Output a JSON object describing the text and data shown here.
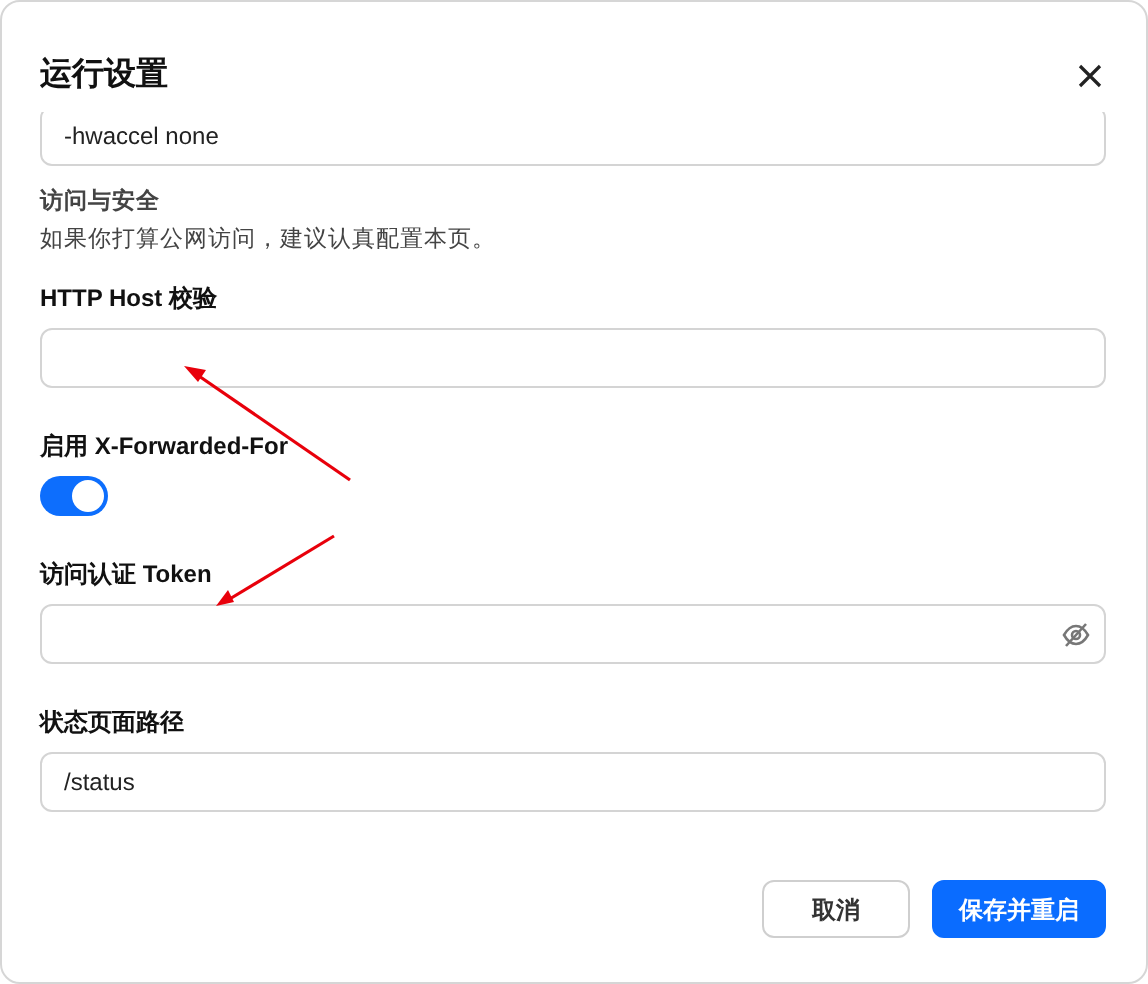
{
  "dialog": {
    "title": "运行设置"
  },
  "items": [
    {
      "kind": "input",
      "value": "-hwaccel none"
    },
    {
      "kind": "section",
      "title": "访问与安全",
      "description": "如果你打算公网访问，建议认真配置本页。"
    },
    {
      "kind": "input",
      "label": "HTTP Host 校验"
    },
    {
      "kind": "switch",
      "label": "启用 X-Forwarded-For",
      "on": true
    },
    {
      "kind": "password",
      "label": "访问认证 Token"
    },
    {
      "kind": "input",
      "label": "状态页面路径",
      "value": "/status"
    }
  ],
  "buttons": [
    {
      "label": "取消",
      "primary": false
    },
    {
      "label": "保存并重启",
      "primary": true
    }
  ]
}
